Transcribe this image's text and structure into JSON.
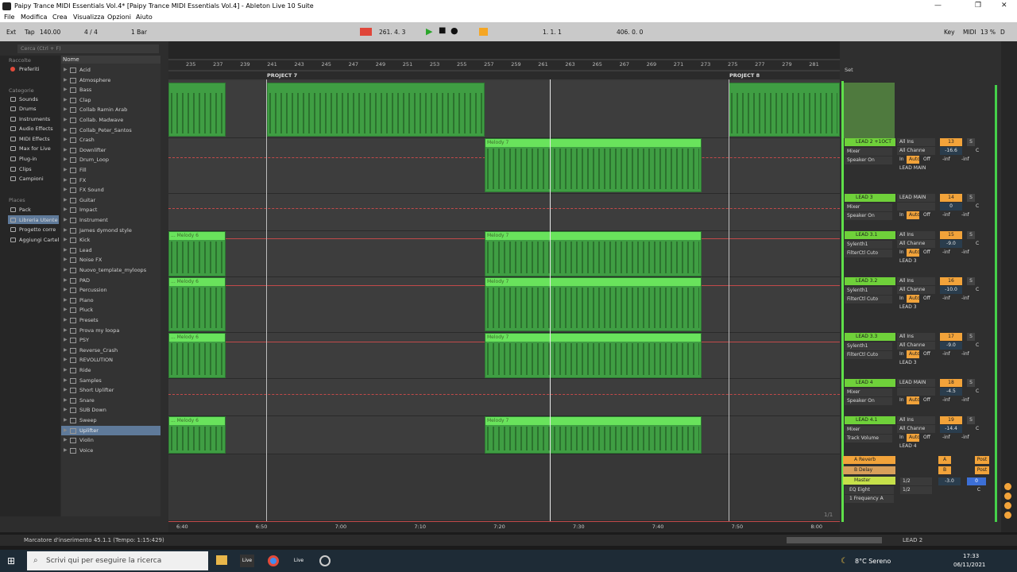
{
  "window": {
    "title": "Paipy Trance MIDI Essentials Vol.4*  [Paipy Trance MIDI Essentials Vol.4] - Ableton Live 10 Suite",
    "controls": [
      "—",
      "❐",
      "✕"
    ]
  },
  "menu": [
    "File",
    "Modifica",
    "Crea",
    "Visualizza",
    "Opzioni",
    "Aiuto"
  ],
  "control_bar": {
    "ext": "Ext",
    "tap": "Tap",
    "tempo": "140.00",
    "meter": "4 / 4",
    "quantize": "1 Bar",
    "position": "261.  4.  3",
    "loop_start": "1.  1.  1",
    "loop_length": "406.  0.  0",
    "key": "Key",
    "midi": "MIDI",
    "cpu": "13 %",
    "d": "D"
  },
  "browser": {
    "search_placeholder": "Cerca (Ctrl + F)",
    "collections_header": "Raccolte",
    "favorites": "Preferiti",
    "categories_header": "Categorie",
    "categories": [
      "Sounds",
      "Drums",
      "Instruments",
      "Audio Effects",
      "MIDI Effects",
      "Max for Live",
      "Plug-in",
      "Clips",
      "Campioni"
    ],
    "places_header": "Places",
    "places": [
      "Pack",
      "Libreria Utente",
      "Progetto corre",
      "Aggiungi Cartel"
    ],
    "name_header": "Nome",
    "items": [
      "Acid",
      "Atmosphere",
      "Bass",
      "Clap",
      "Collab Ramin Arab",
      "Collab. Madwave",
      "Collab_Peter_Santos",
      "Crash",
      "Downlifter",
      "Drum_Loop",
      "Fill",
      "FX",
      "FX Sound",
      "Guitar",
      "Impact",
      "Instrument",
      "James dymond style",
      "Kick",
      "Lead",
      "Noise FX",
      "Nuovo_template_myloops",
      "PAD",
      "Percussion",
      "Piano",
      "Pluck",
      "Presets",
      "Prova my loopa",
      "PSY",
      "Reverse_Crash",
      "REVOLUTION",
      "Ride",
      "Samples",
      "Short Uplifter",
      "Snare",
      "SUB Down",
      "Sweep",
      "Uplifter",
      "Violin",
      "Voice"
    ],
    "selected": "Uplifter"
  },
  "arrangement": {
    "bar_ticks": [
      "235",
      "237",
      "239",
      "241",
      "243",
      "245",
      "247",
      "249",
      "251",
      "253",
      "255",
      "257",
      "259",
      "261",
      "263",
      "265",
      "267",
      "269",
      "271",
      "273",
      "275",
      "277",
      "279",
      "281"
    ],
    "locators": [
      "PROJECT 7",
      "PROJECT 8"
    ],
    "time_ticks": [
      "6:40",
      "6:50",
      "7:00",
      "7:10",
      "7:20",
      "7:30",
      "7:40",
      "7:50",
      "8:00"
    ],
    "clip_melody6": "... Melody 6",
    "clip_melody7": "Melody 7",
    "page": "1/1"
  },
  "mixer": {
    "set_label": "Set",
    "tracks": [
      {
        "name": "LEAD 2 +1OCT",
        "dev1": "Mixer",
        "dev2": "Speaker On",
        "input": "All Ins",
        "chan": "All Channe",
        "out": "LEAD MAIN",
        "num": "13",
        "vol": "-16.6",
        "pan": "C",
        "inf1": "-inf",
        "inf2": "-inf"
      },
      {
        "name": "LEAD 3",
        "dev1": "Mixer",
        "dev2": "Speaker On",
        "input": "LEAD MAIN",
        "chan": "",
        "out": "",
        "num": "14",
        "vol": "0",
        "pan": "C",
        "inf1": "-inf",
        "inf2": "-inf"
      },
      {
        "name": "LEAD 3.1",
        "dev1": "Sylenth1",
        "dev2": "FilterCtl Cuto",
        "input": "All Ins",
        "chan": "All Channe",
        "out": "LEAD 3",
        "num": "15",
        "vol": "-9.0",
        "pan": "C",
        "inf1": "-inf",
        "inf2": "-inf"
      },
      {
        "name": "LEAD 3.2",
        "dev1": "Sylenth1",
        "dev2": "FilterCtl Cuto",
        "input": "All Ins",
        "chan": "All Channe",
        "out": "LEAD 3",
        "num": "16",
        "vol": "-10.0",
        "pan": "C",
        "inf1": "-inf",
        "inf2": "-inf"
      },
      {
        "name": "LEAD 3.3",
        "dev1": "Sylenth1",
        "dev2": "FilterCtl Cuto",
        "input": "All Ins",
        "chan": "All Channe",
        "out": "LEAD 3",
        "num": "17",
        "vol": "-9.0",
        "pan": "C",
        "inf1": "-inf",
        "inf2": "-inf"
      },
      {
        "name": "LEAD 4",
        "dev1": "Mixer",
        "dev2": "Speaker On",
        "input": "LEAD MAIN",
        "chan": "",
        "out": "",
        "num": "18",
        "vol": "-4.5",
        "pan": "C",
        "inf1": "-inf",
        "inf2": "-inf"
      },
      {
        "name": "LEAD 4.1",
        "dev1": "Mixer",
        "dev2": "Track Volume",
        "input": "All Ins",
        "chan": "All Channe",
        "out": "LEAD 4",
        "num": "19",
        "vol": "-14.4",
        "pan": "C",
        "inf1": "-inf",
        "inf2": "-inf"
      }
    ],
    "returns": [
      {
        "name": "A Reverb",
        "letter": "A",
        "post": "Post"
      },
      {
        "name": "B Delay",
        "letter": "B",
        "post": "Post"
      }
    ],
    "master": {
      "name": "Master",
      "dev1": "EQ Eight",
      "dev2": "1 Frequency A",
      "q1": "1/2",
      "q2": "1/2",
      "vol": "-3.0",
      "cue": "0",
      "pan": "C"
    },
    "monitor_in": "In",
    "monitor_auto": "Auto",
    "monitor_off": "Off",
    "solo": "S"
  },
  "status": {
    "text": "Marcatore d'inserimento 45.1.1 (Tempo: 1:15:429)",
    "track": "LEAD 2"
  },
  "taskbar": {
    "search": "Scrivi qui per eseguire la ricerca",
    "weather": "8°C  Sereno",
    "time": "17:33",
    "date": "06/11/2021"
  }
}
